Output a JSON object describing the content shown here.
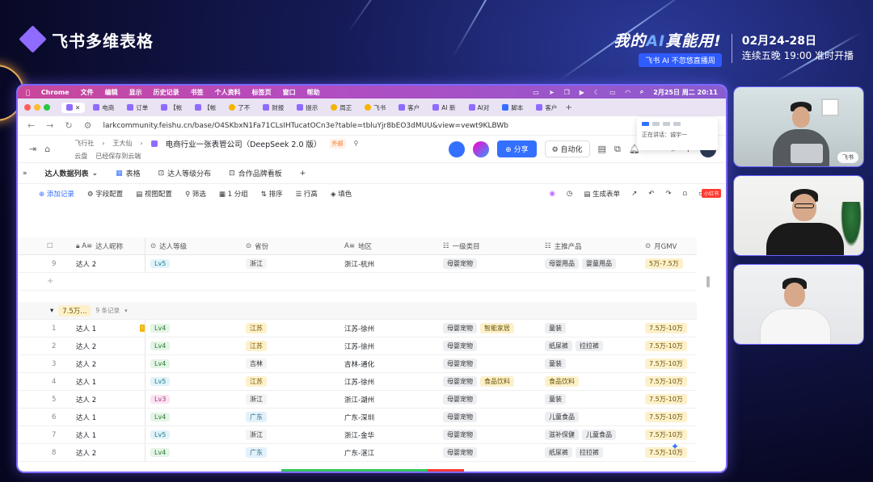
{
  "brand": {
    "title": "飞书多维表格"
  },
  "event": {
    "title_pre": "我的",
    "title_ai": "AI",
    "title_post": "真能用!",
    "pill": "飞书 AI 不忽悠直播周",
    "dates": "02月24-28日",
    "schedule": "连续五晚 19:00 准时开播"
  },
  "menubar": {
    "items": [
      "Chrome",
      "文件",
      "编辑",
      "显示",
      "历史记录",
      "书签",
      "个人资料",
      "标签页",
      "窗口",
      "帮助"
    ],
    "clock": "2月25日 周二 20:11"
  },
  "tabs": [
    "电商",
    "订单",
    "【帐",
    "【帐",
    "了不",
    "财报",
    "提示",
    "周正",
    "飞书",
    "客户",
    "AI 新",
    "AI对",
    "脚本",
    "客户"
  ],
  "url": "larkcommunity.feishu.cn/base/O4SKbxN1Fa71CLsIHTucatOCn3e?table=tbluYjr8bEO3dMUU&view=vewt9KLBWb",
  "header": {
    "crumb1": "飞行社",
    "crumb2": "王大仙",
    "doc_title": "电商行业一张表管公司（DeepSeek 2.0 版）",
    "ext": "外部",
    "location": "云盘",
    "saved": "已经保存到云端",
    "share": "分享",
    "automation": "自动化",
    "notif_count": "1"
  },
  "speaker": {
    "label": "正在讲话：",
    "name": "诚宇一"
  },
  "view_tabs": {
    "table_name": "达人数据列表",
    "views": [
      "表格",
      "达人等级分布",
      "合作品牌看板"
    ]
  },
  "toolbar": {
    "add": "添加记录",
    "fields": "字段配置",
    "view_cfg": "视图配置",
    "filter": "筛选",
    "group": "1 分组",
    "sort": "排序",
    "row_height": "行高",
    "fill": "填色",
    "gen_form": "生成表单"
  },
  "columns": [
    "达人昵称",
    "达人等级",
    "省份",
    "地区",
    "一级类目",
    "主推产品",
    "月GMV"
  ],
  "top_row": {
    "idx": "9",
    "name": "达人 2",
    "lvl": "Lv5",
    "prov": "浙江",
    "area": "浙江-杭州",
    "cats": [
      "母婴宠物"
    ],
    "prods": [
      "母婴用品",
      "婴童用品"
    ],
    "gmv": "5万-7.5万"
  },
  "group": {
    "label": "7.5万...",
    "count": "9 条记录"
  },
  "rows": [
    {
      "idx": "1",
      "name": "达人 1",
      "lvl": "Lv4",
      "prov": "江苏",
      "area": "江苏-徐州",
      "cats": [
        "母婴宠物",
        "智能家居"
      ],
      "prods": [
        "童装"
      ],
      "gmv": "7.5万-10万"
    },
    {
      "idx": "2",
      "name": "达人 2",
      "lvl": "Lv4",
      "prov": "江苏",
      "area": "江苏-徐州",
      "cats": [
        "母婴宠物"
      ],
      "prods": [
        "纸尿裤",
        "拉拉裤"
      ],
      "gmv": "7.5万-10万"
    },
    {
      "idx": "3",
      "name": "达人 2",
      "lvl": "Lv4",
      "prov": "吉林",
      "area": "吉林-通化",
      "cats": [
        "母婴宠物"
      ],
      "prods": [
        "童装"
      ],
      "gmv": "7.5万-10万"
    },
    {
      "idx": "4",
      "name": "达人 1",
      "lvl": "Lv5",
      "prov": "江苏",
      "area": "江苏-徐州",
      "cats": [
        "母婴宠物",
        "食品饮料"
      ],
      "prods": [
        "食品饮料"
      ],
      "gmv": "7.5万-10万"
    },
    {
      "idx": "5",
      "name": "达人 2",
      "lvl": "Lv3",
      "prov": "浙江",
      "area": "浙江-湖州",
      "cats": [
        "母婴宠物"
      ],
      "prods": [
        "童装"
      ],
      "gmv": "7.5万-10万"
    },
    {
      "idx": "6",
      "name": "达人 1",
      "lvl": "Lv4",
      "prov": "广东",
      "area": "广东-深圳",
      "cats": [
        "母婴宠物"
      ],
      "prods": [
        "儿童食品"
      ],
      "gmv": "7.5万-10万"
    },
    {
      "idx": "7",
      "name": "达人 1",
      "lvl": "Lv5",
      "prov": "浙江",
      "area": "浙江-金华",
      "cats": [
        "母婴宠物"
      ],
      "prods": [
        "滋补保健",
        "儿童食品"
      ],
      "gmv": "7.5万-10万"
    },
    {
      "idx": "8",
      "name": "达人 2",
      "lvl": "Lv4",
      "prov": "广东",
      "area": "广东-湛江",
      "cats": [
        "母婴宠物"
      ],
      "prods": [
        "纸尿裤",
        "拉拉裤"
      ],
      "gmv": "7.5万-10万"
    }
  ],
  "cam1_label": "飞书",
  "red_badge": "小红书"
}
